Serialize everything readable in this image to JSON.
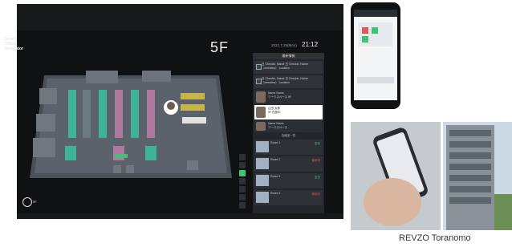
{
  "dashboard": {
    "brand": [
      "Smart",
      "Office",
      "Navigator"
    ],
    "floor": "5F",
    "date": "2022.7.25(Mon)",
    "time": "21:12",
    "exit_label": "5F"
  },
  "panel": {
    "title": "最新情報",
    "items": [
      {
        "text": "日 Checkin, Name 日 Checkin, Name 〔checkins〕 Location"
      },
      {
        "text": "日 Checkin, Name 日 Checkin, Name 〔checkins〕 Location"
      }
    ],
    "people": [
      {
        "name": "Name Name",
        "meta": "ワークスペース 5F"
      },
      {
        "name": "山田 太郎",
        "meta": "5F 在席中"
      },
      {
        "name": "Name Name",
        "meta": "ワークスペース"
      }
    ],
    "rooms_title": "会議室一覧",
    "rooms": [
      {
        "name": "Room 1",
        "status": "空き"
      },
      {
        "name": "Room 2",
        "status": "使用中"
      },
      {
        "name": "Room 3",
        "status": "空き"
      },
      {
        "name": "Room 4",
        "status": "使用中"
      }
    ]
  },
  "caption": "REVZO Toranomo",
  "colors": {
    "accent": "#3fc271",
    "busy": "#e35757",
    "panel": "#23262a"
  }
}
